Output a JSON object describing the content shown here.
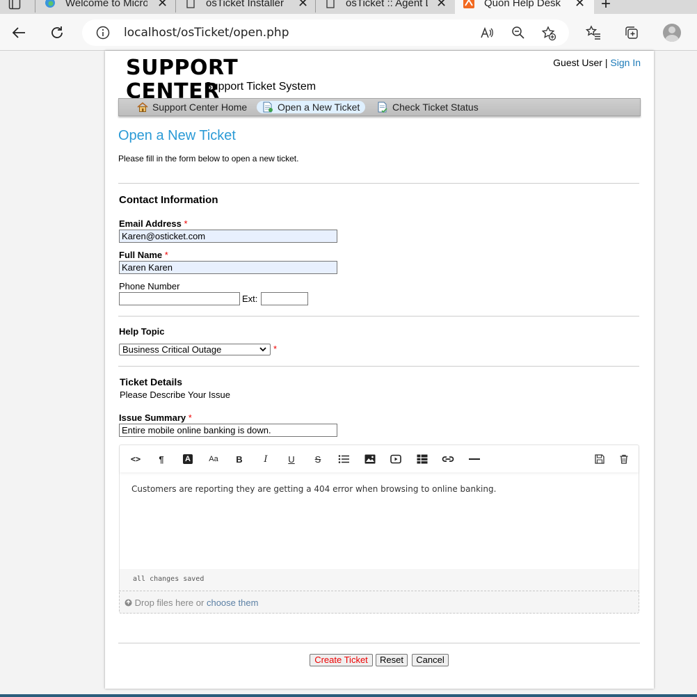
{
  "browser": {
    "tabs": [
      {
        "title": "Welcome to Micro",
        "active": false
      },
      {
        "title": "osTicket Installer",
        "active": false
      },
      {
        "title": "osTicket :: Agent L",
        "active": false
      },
      {
        "title": "Quon Help Desk",
        "active": true
      }
    ],
    "url": "localhost/osTicket/open.php"
  },
  "header": {
    "logo_title": "SUPPORT CENTER",
    "logo_subtitle": "Support Ticket System",
    "user_label": "Guest User",
    "separator": " | ",
    "signin_label": "Sign In"
  },
  "nav": {
    "items": [
      {
        "label": "Support Center Home",
        "icon": "home-icon",
        "active": false
      },
      {
        "label": "Open a New Ticket",
        "icon": "new-ticket-icon",
        "active": true
      },
      {
        "label": "Check Ticket Status",
        "icon": "ticket-status-icon",
        "active": false
      }
    ]
  },
  "page": {
    "title": "Open a New Ticket",
    "intro": "Please fill in the form below to open a new ticket."
  },
  "contact": {
    "heading": "Contact Information",
    "email_label": "Email Address",
    "email_value": "Karen@osticket.com",
    "name_label": "Full Name",
    "name_value": "Karen Karen",
    "phone_label": "Phone Number",
    "phone_value": "",
    "ext_label": "Ext:",
    "ext_value": ""
  },
  "help_topic": {
    "label": "Help Topic",
    "selected": "Business Critical Outage"
  },
  "ticket_details": {
    "heading": "Ticket Details",
    "subheading": "Please Describe Your Issue",
    "summary_label": "Issue Summary",
    "summary_value": "Entire mobile online banking is down.",
    "body": "Customers are reporting they are getting a 404 error when browsing to online banking.",
    "status": "all changes saved",
    "required_mark": "*"
  },
  "editor_toolbar": {
    "icons": [
      "html-icon",
      "paragraph-icon",
      "text-color-icon",
      "font-size-icon",
      "bold-icon",
      "italic-icon",
      "underline-icon",
      "strikethrough-icon",
      "list-icon",
      "image-icon",
      "video-icon",
      "table-icon",
      "link-icon",
      "horizontal-rule-icon",
      "save-draft-icon",
      "delete-draft-icon"
    ],
    "glyphs": {
      "html": "<>",
      "paragraph": "¶",
      "text_color": "A",
      "font_size": "Aa",
      "bold": "B",
      "italic": "I",
      "underline": "U",
      "strike": "S"
    }
  },
  "attachments": {
    "drop_text": "Drop files here or",
    "choose_link": "choose them"
  },
  "actions": {
    "create": "Create Ticket",
    "reset": "Reset",
    "cancel": "Cancel"
  },
  "colors": {
    "accent": "#2a9ad6",
    "link": "#1b7ab8",
    "required": "#e00000",
    "autofill": "#e8f0fe"
  }
}
